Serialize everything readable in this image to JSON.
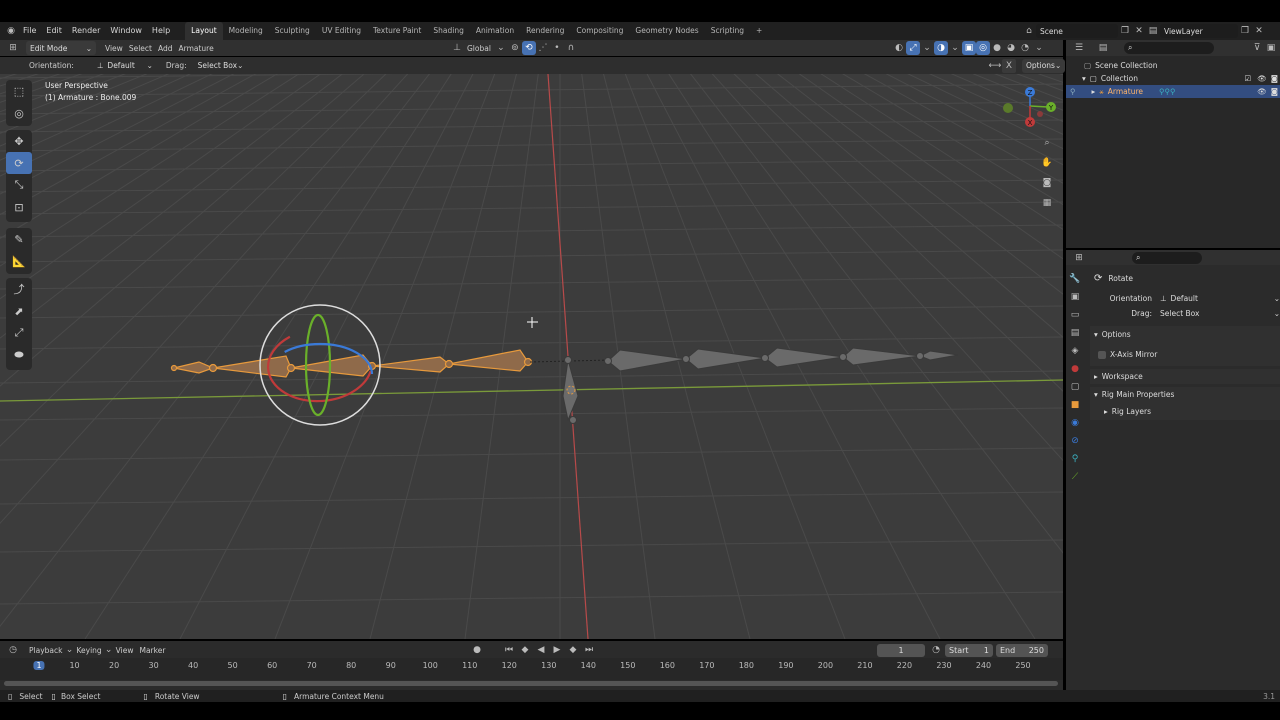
{
  "topbar": {
    "menus": [
      "File",
      "Edit",
      "Render",
      "Window",
      "Help"
    ],
    "workspaces": [
      "Layout",
      "Modeling",
      "Sculpting",
      "UV Editing",
      "Texture Paint",
      "Shading",
      "Animation",
      "Rendering",
      "Compositing",
      "Geometry Nodes",
      "Scripting"
    ],
    "add_tab": "+",
    "scene": "Scene",
    "view_layer": "ViewLayer"
  },
  "viewport_header": {
    "mode": "Edit Mode",
    "menus": [
      "View",
      "Select",
      "Add",
      "Armature"
    ],
    "transform_orientation": "Global"
  },
  "tool_settings": {
    "orientation_label": "Orientation:",
    "orientation_value": "Default",
    "drag_label": "Drag:",
    "drag_value": "Select Box",
    "options_label": "Options"
  },
  "viewport": {
    "view_name": "User Perspective",
    "object_info": "(1) Armature : Bone.009",
    "gizmo_axes": {
      "x": "X",
      "y": "Y",
      "z": "Z"
    }
  },
  "outliner": {
    "search_placeholder": "",
    "items": [
      {
        "label": "Scene Collection"
      },
      {
        "label": "Collection"
      },
      {
        "label": "Armature"
      }
    ]
  },
  "properties": {
    "search_placeholder": "",
    "tool_name": "Rotate",
    "orientation_label": "Orientation",
    "orientation_value": "Default",
    "drag_label": "Drag:",
    "drag_value": "Select Box",
    "panels": {
      "options": "Options",
      "x_axis_mirror": "X-Axis Mirror",
      "workspace": "Workspace",
      "rig_main": "Rig Main Properties",
      "rig_layers": "Rig Layers"
    }
  },
  "timeline": {
    "menus": [
      "Playback",
      "Keying",
      "View",
      "Marker"
    ],
    "current_frame": "1",
    "start_label": "Start",
    "start_value": "1",
    "end_label": "End",
    "end_value": "250",
    "ticks": [
      "1",
      "10",
      "20",
      "30",
      "40",
      "50",
      "60",
      "70",
      "80",
      "90",
      "100",
      "110",
      "120",
      "130",
      "140",
      "150",
      "160",
      "170",
      "180",
      "190",
      "200",
      "210",
      "220",
      "230",
      "240",
      "250"
    ]
  },
  "statusbar": {
    "select": "Select",
    "box_select": "Box Select",
    "rotate_view": "Rotate View",
    "context_menu": "Armature Context Menu",
    "version": "3.1"
  },
  "colors": {
    "selected_bone": "#e89a3c",
    "accent": "#4772b3",
    "x_axis": "#c03a3a",
    "y_axis": "#6a9a2a"
  }
}
